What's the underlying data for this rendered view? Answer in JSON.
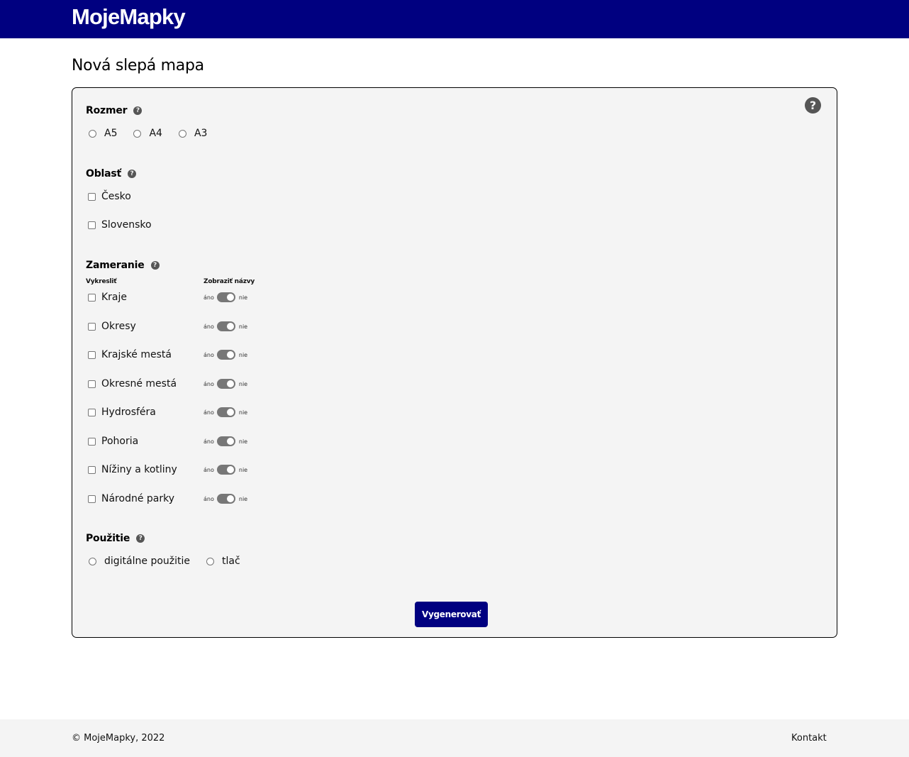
{
  "header": {
    "brand": "MojeMapky"
  },
  "page": {
    "title": "Nová slepá mapa"
  },
  "help": {
    "icon": "question-circle-icon",
    "glyph": "?"
  },
  "size": {
    "title": "Rozmer",
    "options": [
      "A5",
      "A4",
      "A3"
    ]
  },
  "region": {
    "title": "Oblasť",
    "options": [
      "Česko",
      "Slovensko"
    ]
  },
  "focus": {
    "title": "Zameranie",
    "col_draw": "Vykresliť",
    "col_names": "Zobraziť názvy",
    "toggle_yes": "áno",
    "toggle_no": "nie",
    "items": [
      "Kraje",
      "Okresy",
      "Krajské mestá",
      "Okresné mestá",
      "Hydrosféra",
      "Pohoria",
      "Nížiny a kotliny",
      "Národné parky"
    ]
  },
  "usage": {
    "title": "Použitie",
    "options": [
      "digitálne použitie",
      "tlač"
    ]
  },
  "actions": {
    "generate_label": "Vygenerovať"
  },
  "footer": {
    "copyright": "© MojeMapky, 2022",
    "contact": "Kontakt"
  },
  "colors": {
    "brand": "#000080",
    "panel": "#f4f4f4",
    "toggle": "#777777"
  }
}
